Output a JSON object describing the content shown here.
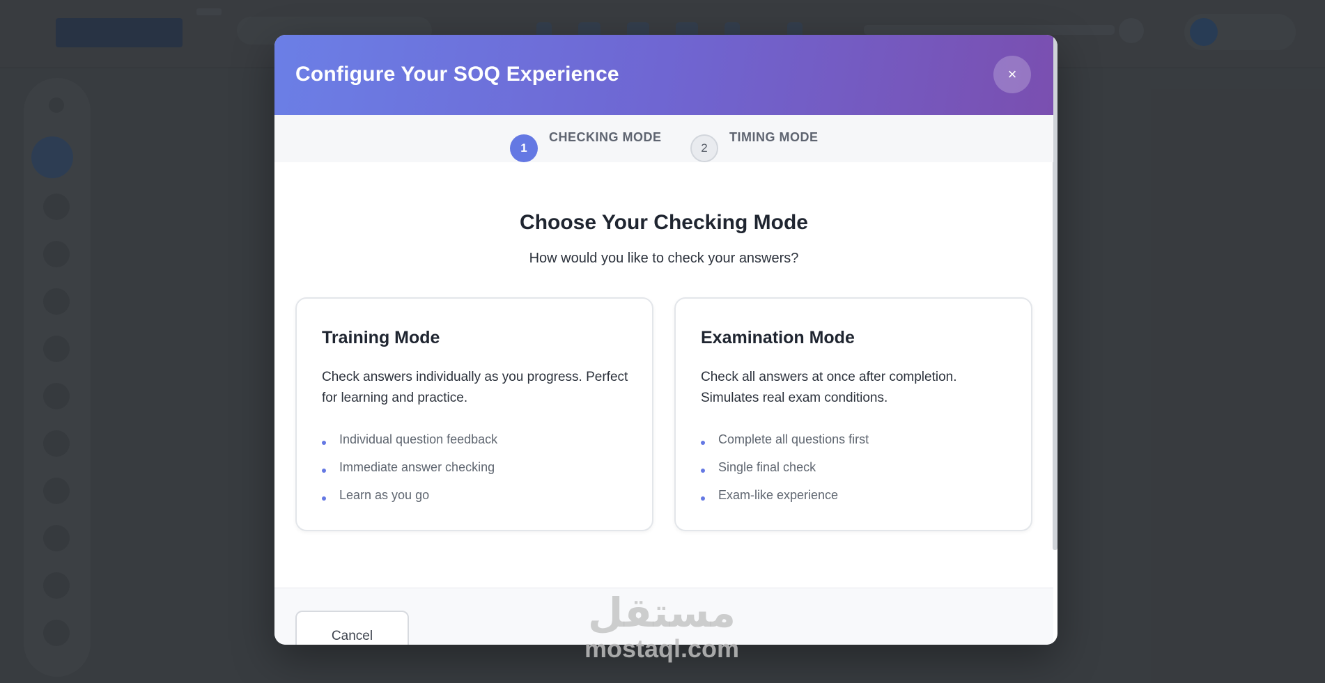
{
  "modal": {
    "title": "Configure Your SOQ Experience",
    "close_icon": "×",
    "steps": [
      {
        "number": "1",
        "label": "CHECKING MODE",
        "active": true
      },
      {
        "number": "2",
        "label": "TIMING MODE",
        "active": false
      }
    ],
    "heading": "Choose Your Checking Mode",
    "subheading": "How would you like to check your answers?",
    "cards": [
      {
        "title": "Training Mode",
        "description": "Check answers individually as you progress. Perfect for learning and practice.",
        "features": [
          "Individual question feedback",
          "Immediate answer checking",
          "Learn as you go"
        ]
      },
      {
        "title": "Examination Mode",
        "description": "Check all answers at once after completion. Simulates real exam conditions.",
        "features": [
          "Complete all questions first",
          "Single final check",
          "Exam-like experience"
        ]
      }
    ],
    "cancel_label": "Cancel"
  },
  "watermark": {
    "arabic": "مستقل",
    "latin": "mostaql.com"
  },
  "colors": {
    "accent": "#6478e3",
    "header_start": "#6b7fe6",
    "header_end": "#7a4fb0"
  }
}
